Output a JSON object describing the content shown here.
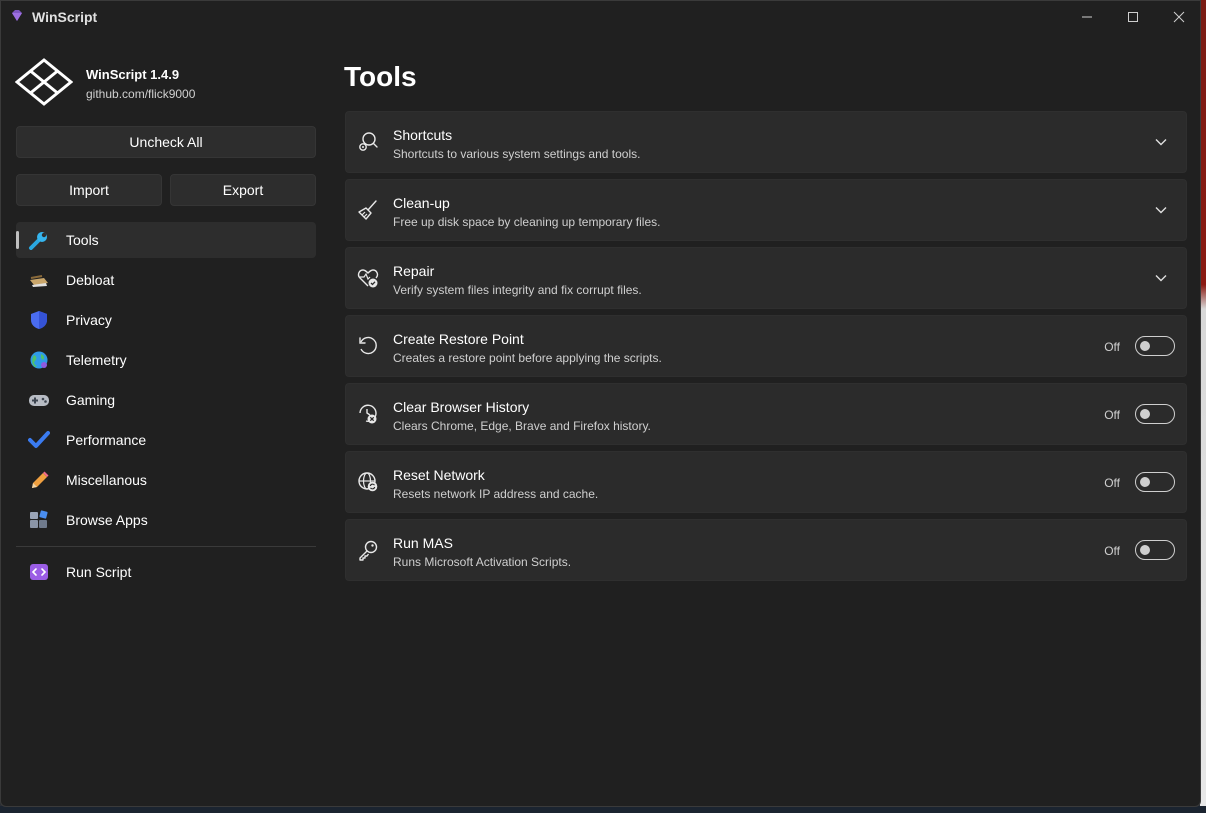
{
  "window": {
    "title": "WinScript"
  },
  "app": {
    "name": "WinScript 1.4.9",
    "url": "github.com/flick9000"
  },
  "sidebar": {
    "uncheck_label": "Uncheck All",
    "import_label": "Import",
    "export_label": "Export",
    "items": [
      {
        "label": "Tools",
        "icon": "wrench-icon",
        "active": true
      },
      {
        "label": "Debloat",
        "icon": "broom-icon"
      },
      {
        "label": "Privacy",
        "icon": "shield-icon"
      },
      {
        "label": "Telemetry",
        "icon": "globe-icon"
      },
      {
        "label": "Gaming",
        "icon": "gamepad-icon"
      },
      {
        "label": "Performance",
        "icon": "checkmark-icon"
      },
      {
        "label": "Miscellanous",
        "icon": "pencil-icon"
      },
      {
        "label": "Browse Apps",
        "icon": "apps-icon"
      }
    ],
    "run_script_label": "Run Script"
  },
  "main": {
    "title": "Tools",
    "cards": [
      {
        "title": "Shortcuts",
        "desc": "Shortcuts to various system settings and tools.",
        "control": "expander",
        "icon": "search-gear-icon"
      },
      {
        "title": "Clean-up",
        "desc": "Free up disk space by cleaning up temporary files.",
        "control": "expander",
        "icon": "broom-icon"
      },
      {
        "title": "Repair",
        "desc": "Verify system files integrity and fix corrupt files.",
        "control": "expander",
        "icon": "heart-check-icon"
      },
      {
        "title": "Create Restore Point",
        "desc": "Creates a restore point before applying the scripts.",
        "control": "toggle",
        "state": "Off",
        "icon": "restore-icon"
      },
      {
        "title": "Clear Browser History",
        "desc": "Clears Chrome, Edge, Brave and Firefox history.",
        "control": "toggle",
        "state": "Off",
        "icon": "history-clear-icon"
      },
      {
        "title": "Reset Network",
        "desc": "Resets network IP address and cache.",
        "control": "toggle",
        "state": "Off",
        "icon": "network-reset-icon"
      },
      {
        "title": "Run MAS",
        "desc": "Runs Microsoft Activation Scripts.",
        "control": "toggle",
        "state": "Off",
        "icon": "key-icon"
      }
    ]
  },
  "colors": {
    "background": "#202020",
    "card": "#2b2b2b",
    "button": "#2d2d2d"
  }
}
